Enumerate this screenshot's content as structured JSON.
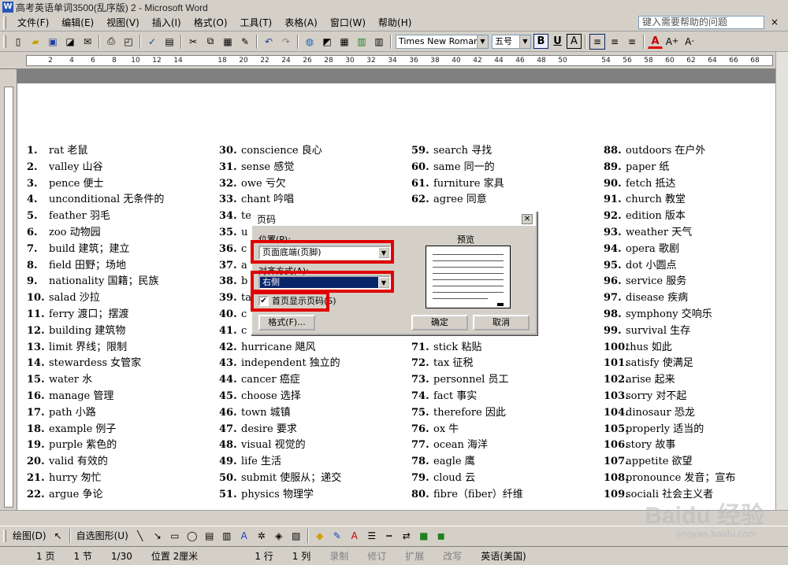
{
  "window": {
    "title": "高考英语单词3500(乱序版) 2 - Microsoft Word",
    "app_icon": "W"
  },
  "menu": {
    "items": [
      "文件(F)",
      "编辑(E)",
      "视图(V)",
      "插入(I)",
      "格式(O)",
      "工具(T)",
      "表格(A)",
      "窗口(W)",
      "帮助(H)"
    ],
    "help_placeholder": "键入需要帮助的问题",
    "close_glyph": "×"
  },
  "toolbar": {
    "font": "Times New Roman",
    "size": "五号",
    "bold": "B",
    "underline": "U",
    "char_border": "A",
    "font_color": "A"
  },
  "ruler": {
    "ticks": [
      "2",
      "4",
      "6",
      "8",
      "10",
      "12",
      "14",
      "18",
      "20",
      "22",
      "24",
      "26",
      "28",
      "30",
      "32",
      "34",
      "36",
      "38",
      "40",
      "42",
      "44",
      "46",
      "48",
      "50",
      "54",
      "56",
      "58",
      "60",
      "62",
      "64",
      "66",
      "68"
    ]
  },
  "document": {
    "columns": [
      [
        {
          "n": "1.",
          "t": "rat 老鼠"
        },
        {
          "n": "2.",
          "t": "valley 山谷"
        },
        {
          "n": "3.",
          "t": "pence 便士"
        },
        {
          "n": "4.",
          "t": "unconditional 无条件的"
        },
        {
          "n": "5.",
          "t": "feather 羽毛"
        },
        {
          "n": "6.",
          "t": "zoo 动物园"
        },
        {
          "n": "7.",
          "t": "build 建筑；建立"
        },
        {
          "n": "8.",
          "t": "field 田野；场地"
        },
        {
          "n": "9.",
          "t": "nationality 国籍；民族"
        },
        {
          "n": "10.",
          "t": "salad 沙拉"
        },
        {
          "n": "11.",
          "t": "ferry 渡口；摆渡"
        },
        {
          "n": "12.",
          "t": "building 建筑物"
        },
        {
          "n": "13.",
          "t": "limit 界线；限制"
        },
        {
          "n": "14.",
          "t": "stewardess 女管家"
        },
        {
          "n": "15.",
          "t": "water 水"
        },
        {
          "n": "16.",
          "t": "manage 管理"
        },
        {
          "n": "17.",
          "t": "path 小路"
        },
        {
          "n": "18.",
          "t": "example 例子"
        },
        {
          "n": "19.",
          "t": "purple 紫色的"
        },
        {
          "n": "20.",
          "t": "valid 有效的"
        },
        {
          "n": "21.",
          "t": "hurry 匆忙"
        },
        {
          "n": "22.",
          "t": "argue 争论"
        }
      ],
      [
        {
          "n": "30.",
          "t": "conscience 良心"
        },
        {
          "n": "31.",
          "t": "sense 感觉"
        },
        {
          "n": "32.",
          "t": "owe 亏欠"
        },
        {
          "n": "33.",
          "t": "chant 吟唱"
        },
        {
          "n": "34.",
          "t": "te"
        },
        {
          "n": "35.",
          "t": "u"
        },
        {
          "n": "36.",
          "t": "c"
        },
        {
          "n": "37.",
          "t": "a"
        },
        {
          "n": "38.",
          "t": "b"
        },
        {
          "n": "39.",
          "t": "ta"
        },
        {
          "n": "40.",
          "t": "c"
        },
        {
          "n": "41.",
          "t": "c"
        },
        {
          "n": "42.",
          "t": "hurricane 飓风"
        },
        {
          "n": "43.",
          "t": "independent 独立的"
        },
        {
          "n": "44.",
          "t": "cancer 癌症"
        },
        {
          "n": "45.",
          "t": "choose 选择"
        },
        {
          "n": "46.",
          "t": "town 城镇"
        },
        {
          "n": "47.",
          "t": "desire 要求"
        },
        {
          "n": "48.",
          "t": "visual 视觉的"
        },
        {
          "n": "49.",
          "t": "life 生活"
        },
        {
          "n": "50.",
          "t": "submit 使服从；递交"
        },
        {
          "n": "51.",
          "t": "physics 物理学"
        }
      ],
      [
        {
          "n": "59.",
          "t": "search 寻找"
        },
        {
          "n": "60.",
          "t": "same 同一的"
        },
        {
          "n": "61.",
          "t": "furniture 家具"
        },
        {
          "n": "62.",
          "t": "agree 同意"
        },
        {
          "n": "",
          "t": ""
        },
        {
          "n": "",
          "t": ""
        },
        {
          "n": "",
          "t": ""
        },
        {
          "n": "",
          "t": ""
        },
        {
          "n": "",
          "t": ""
        },
        {
          "n": "",
          "t": ""
        },
        {
          "n": "",
          "t": ""
        },
        {
          "n": "",
          "t": ""
        },
        {
          "n": "71.",
          "t": "stick 粘贴"
        },
        {
          "n": "72.",
          "t": "tax 征税"
        },
        {
          "n": "73.",
          "t": "personnel 员工"
        },
        {
          "n": "74.",
          "t": "fact 事实"
        },
        {
          "n": "75.",
          "t": "therefore 因此"
        },
        {
          "n": "76.",
          "t": "ox 牛"
        },
        {
          "n": "77.",
          "t": "ocean 海洋"
        },
        {
          "n": "78.",
          "t": "eagle 鹰"
        },
        {
          "n": "79.",
          "t": "cloud 云"
        },
        {
          "n": "80.",
          "t": "fibre（fiber）纤维"
        }
      ],
      [
        {
          "n": "88.",
          "t": "outdoors 在户外"
        },
        {
          "n": "89.",
          "t": "paper 纸"
        },
        {
          "n": "90.",
          "t": "fetch 抵达"
        },
        {
          "n": "91.",
          "t": "church 教堂"
        },
        {
          "n": "92.",
          "t": "edition 版本"
        },
        {
          "n": "93.",
          "t": "weather 天气"
        },
        {
          "n": "94.",
          "t": "opera 歌剧"
        },
        {
          "n": "95.",
          "t": "dot 小圆点"
        },
        {
          "n": "96.",
          "t": "service 服务"
        },
        {
          "n": "97.",
          "t": "disease 疾病"
        },
        {
          "n": "98.",
          "t": "symphony 交响乐"
        },
        {
          "n": "99.",
          "t": "survival 生存"
        },
        {
          "n": "100.",
          "t": "thus 如此"
        },
        {
          "n": "101.",
          "t": "satisfy 使满足"
        },
        {
          "n": "102.",
          "t": "arise 起来"
        },
        {
          "n": "103.",
          "t": "sorry 对不起"
        },
        {
          "n": "104.",
          "t": "dinosaur 恐龙"
        },
        {
          "n": "105.",
          "t": "properly 适当的"
        },
        {
          "n": "106.",
          "t": "story 故事"
        },
        {
          "n": "107.",
          "t": "appetite 欲望"
        },
        {
          "n": "108.",
          "t": "pronounce 发音；宣布"
        },
        {
          "n": "109.",
          "t": "sociali 社会主义者"
        }
      ]
    ]
  },
  "dialog": {
    "title": "页码",
    "position_label": "位置(P):",
    "position_value": "页面底端(页脚)",
    "alignment_label": "对齐方式(A):",
    "alignment_value": "右侧",
    "first_page_label": "首页显示页码(S)",
    "preview_label": "预览",
    "format_button": "格式(F)...",
    "ok_button": "确定",
    "cancel_button": "取消",
    "highlight_color": "#e00000"
  },
  "drawbar": {
    "draw_label": "绘图(D)",
    "autoshape_label": "自选图形(U)"
  },
  "status": {
    "page": "1 页",
    "section": "1 节",
    "pages": "1/30",
    "position": "位置 2厘米",
    "line": "1 行",
    "column": "1 列",
    "rec": "录制",
    "trk": "修订",
    "ext": "扩展",
    "ovr": "改写",
    "lang": "英语(美国)"
  },
  "watermark": {
    "text": "Baidu 经验",
    "sub": "jingyan.baidu.com"
  }
}
